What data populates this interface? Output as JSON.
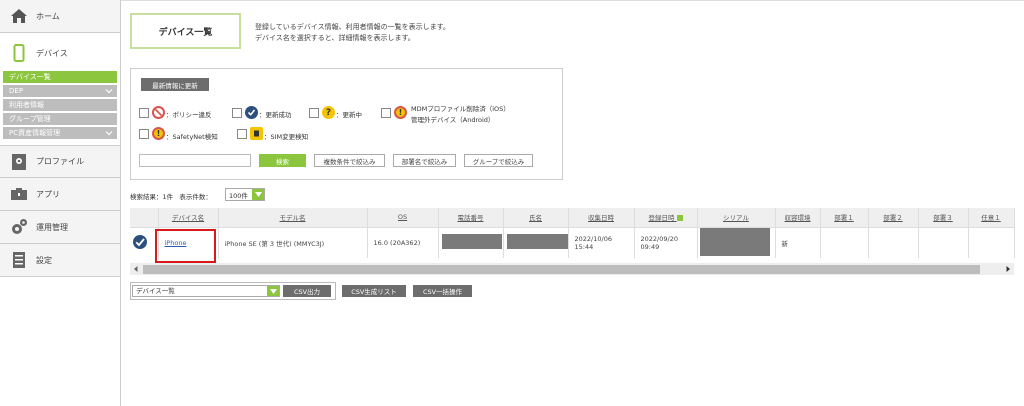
{
  "sidebar": {
    "home": "ホーム",
    "device": "デバイス",
    "sub_items": [
      {
        "label": "デバイス一覧",
        "active": true,
        "chevron": false
      },
      {
        "label": "DEP",
        "active": false,
        "chevron": true
      },
      {
        "label": "利用者情報",
        "active": false,
        "chevron": false
      },
      {
        "label": "グループ管理",
        "active": false,
        "chevron": false
      },
      {
        "label": "PC資産情報管理",
        "active": false,
        "chevron": true
      }
    ],
    "profile": "プロファイル",
    "apps": "アプリ",
    "operation": "運用管理",
    "settings": "設定"
  },
  "header": {
    "title": "デバイス一覧",
    "desc1": "登録しているデバイス情報、利用者情報の一覧を表示します。",
    "desc2": "デバイス名を選択すると、詳細情報を表示します。"
  },
  "filter": {
    "update_button": "最新情報に更新",
    "status": [
      {
        "label": "：ポリシー違反"
      },
      {
        "label": "：更新成功"
      },
      {
        "label": "：更新中"
      },
      {
        "label": "MDMプロファイル削除済（iOS）"
      },
      {
        "label": "管理外デバイス（Android）"
      },
      {
        "label": "：SafetyNet検知"
      },
      {
        "label": "：SIM変更検知"
      }
    ],
    "search_button": "検索",
    "multi_filter": "複数条件で絞込み",
    "dept_filter": "部署名で絞込み",
    "group_filter": "グループで絞込み"
  },
  "results": {
    "count_text": "検索結果：1件",
    "per_page_label": "表示件数：",
    "per_page_value": "100件"
  },
  "table": {
    "headers": [
      "デバイス名",
      "モデル名",
      "OS",
      "電話番号",
      "氏名",
      "収集日時",
      "登録日時",
      "シリアル",
      "収容環境",
      "部署１",
      "部署２",
      "部署３",
      "任意１"
    ],
    "row": {
      "device_name": "iPhone",
      "model": "iPhone SE (第 3 世代) (MMYC3J)",
      "os": "16.0 (20A362)",
      "collected_date": "2022/10/06",
      "collected_time": "15:44",
      "registered_date": "2022/09/20",
      "registered_time": "09:49",
      "environment": "新"
    }
  },
  "bottom": {
    "list_select": "デバイス一覧",
    "csv_export": "CSV出力",
    "csv_generate": "CSV生成リスト",
    "csv_bulk": "CSV一括操作"
  },
  "colors": {
    "accent": "#8cc63f",
    "title_border": "#c9df9e",
    "highlight": "#d7191c"
  }
}
